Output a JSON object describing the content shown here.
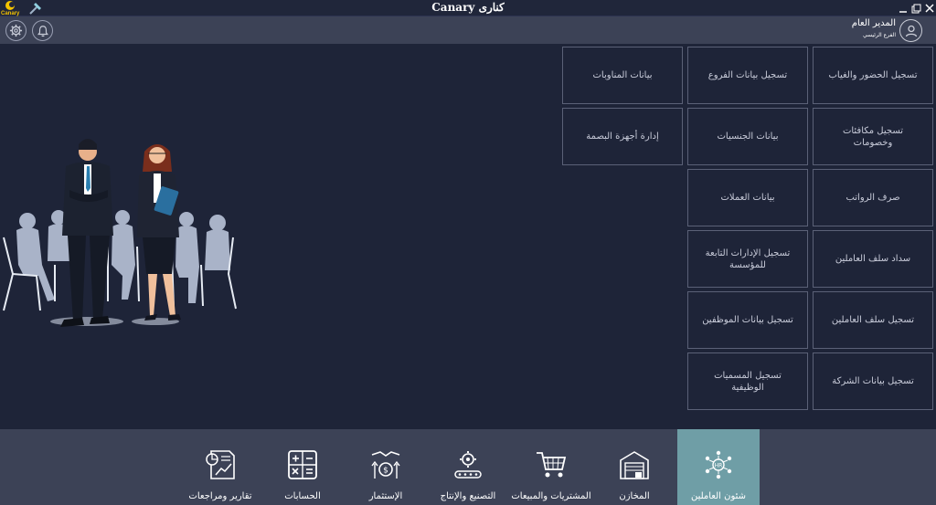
{
  "window": {
    "title": "Canary كنارى",
    "logo_text": "Canary"
  },
  "header": {
    "user_name": "المدير العام",
    "branch": "الفرع الرئيسي",
    "settings_icon": "gear-icon",
    "notifications_icon": "bell-icon",
    "avatar_icon": "user-icon"
  },
  "tiles": [
    {
      "label": "تسجيل الحضور والغياب"
    },
    {
      "label": "تسجيل بيانات الفروع"
    },
    {
      "label": "بيانات المناوبات"
    },
    {
      "label": "تسجيل مكافئات وخصومات"
    },
    {
      "label": "بيانات الجنسيات"
    },
    {
      "label": "إدارة أجهزة البصمة"
    },
    {
      "label": "صرف الرواتب"
    },
    {
      "label": "بيانات العملات"
    },
    {
      "label": "سداد سلف العاملين"
    },
    {
      "label": "تسجيل الإدارات التابعة للمؤسسة"
    },
    {
      "label": "تسجيل سلف العاملين"
    },
    {
      "label": "تسجيل بيانات الموظفين"
    },
    {
      "label": "تسجيل بيانات الشركة"
    },
    {
      "label": "تسجيل المسميات الوظيفية"
    }
  ],
  "nav": [
    {
      "label": "شئون العاملين",
      "icon": "hr-people-icon",
      "active": true
    },
    {
      "label": "المخازن",
      "icon": "warehouse-icon",
      "active": false
    },
    {
      "label": "المشتريات والمبيعات",
      "icon": "cart-icon",
      "active": false
    },
    {
      "label": "التصنيع والإنتاج",
      "icon": "manufacturing-icon",
      "active": false
    },
    {
      "label": "الإستثمار",
      "icon": "investment-icon",
      "active": false
    },
    {
      "label": "الحسابات",
      "icon": "calculator-icon",
      "active": false
    },
    {
      "label": "تقارير ومراجعات",
      "icon": "reports-icon",
      "active": false
    }
  ],
  "colors": {
    "background": "#1e2438",
    "bar": "#3c4256",
    "active_nav": "#6f9ea6",
    "tile_border": "#5b6177",
    "logo_yellow": "#f5c400"
  }
}
